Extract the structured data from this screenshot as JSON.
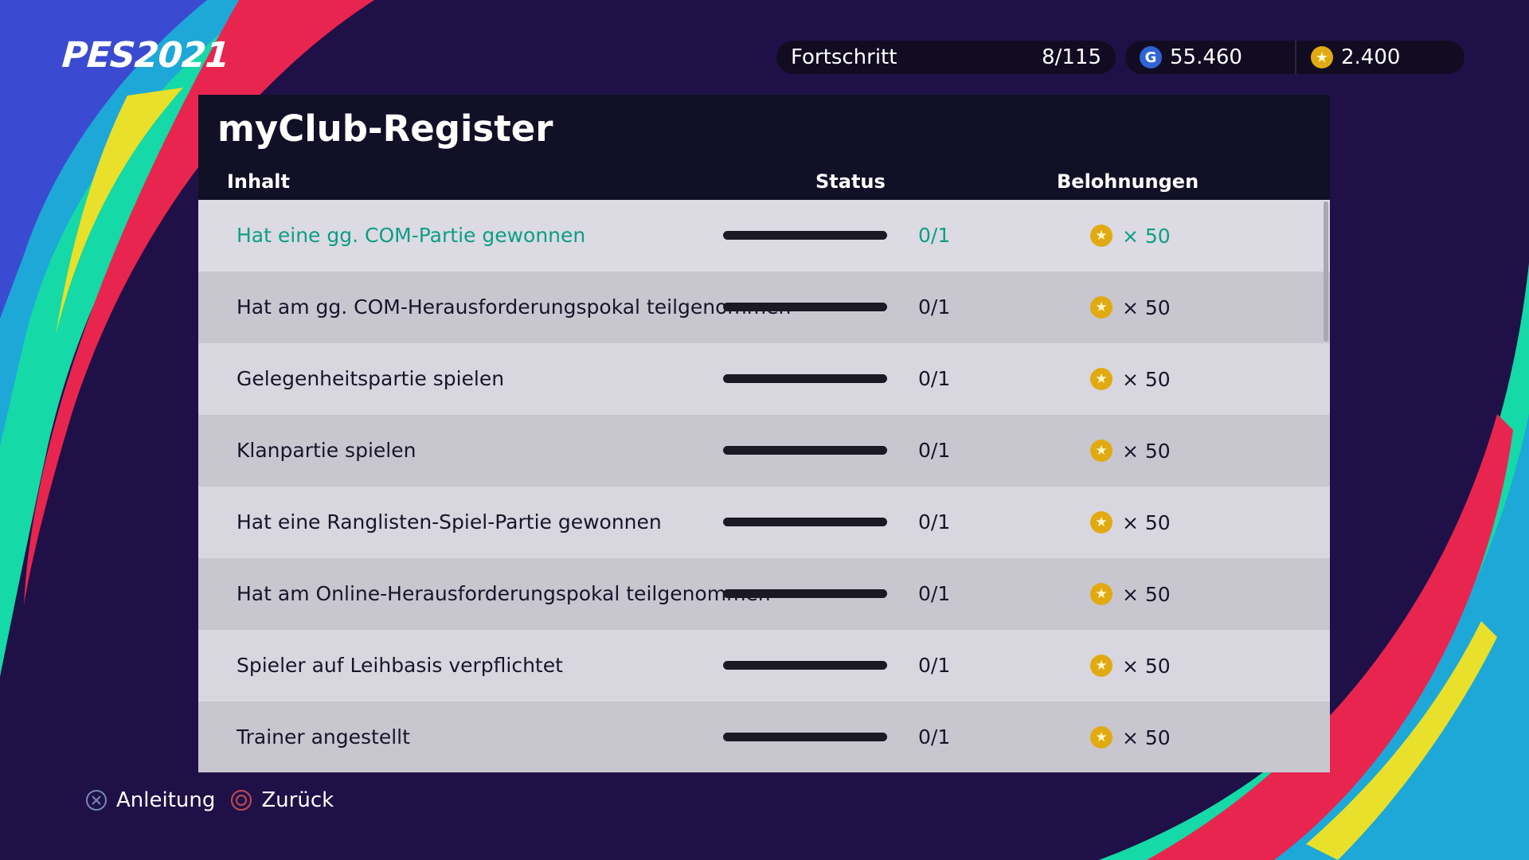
{
  "app": {
    "logo": "PES2021"
  },
  "topbar": {
    "progress_label": "Fortschritt",
    "progress_value": "8/115",
    "gp_amount": "55.460",
    "coins_amount": "2.400",
    "gp_icon": "G"
  },
  "panel": {
    "title": "myClub-Register",
    "columns": {
      "content": "Inhalt",
      "status": "Status",
      "rewards": "Belohnungen"
    }
  },
  "rows": [
    {
      "label": "Hat eine gg. COM-Partie gewonnen",
      "status": "0/1",
      "progress": 0,
      "reward": "× 50",
      "selected": true
    },
    {
      "label": "Hat am gg. COM-Herausforderungspokal teilgenommen",
      "status": "0/1",
      "progress": 0,
      "reward": "× 50",
      "selected": false
    },
    {
      "label": "Gelegenheitspartie spielen",
      "status": "0/1",
      "progress": 0,
      "reward": "× 50",
      "selected": false
    },
    {
      "label": "Klanpartie spielen",
      "status": "0/1",
      "progress": 0,
      "reward": "× 50",
      "selected": false
    },
    {
      "label": "Hat eine Ranglisten-Spiel-Partie gewonnen",
      "status": "0/1",
      "progress": 0,
      "reward": "× 50",
      "selected": false
    },
    {
      "label": "Hat am Online-Herausforderungspokal teilgenommen",
      "status": "0/1",
      "progress": 0,
      "reward": "× 50",
      "selected": false
    },
    {
      "label": "Spieler auf Leihbasis verpflichtet",
      "status": "0/1",
      "progress": 0,
      "reward": "× 50",
      "selected": false
    },
    {
      "label": "Trainer angestellt",
      "status": "0/1",
      "progress": 0,
      "reward": "× 50",
      "selected": false
    }
  ],
  "footer": {
    "guide_label": "Anleitung",
    "back_label": "Zurück"
  },
  "icons": {
    "coin": "coin-star-icon",
    "gp": "gp-icon",
    "guide": "cross-button-icon",
    "back": "circle-button-icon"
  },
  "colors": {
    "background": "#1f1147",
    "accent": "#0d9e86",
    "coin": "#e2aa12",
    "gp": "#2f63d6"
  }
}
